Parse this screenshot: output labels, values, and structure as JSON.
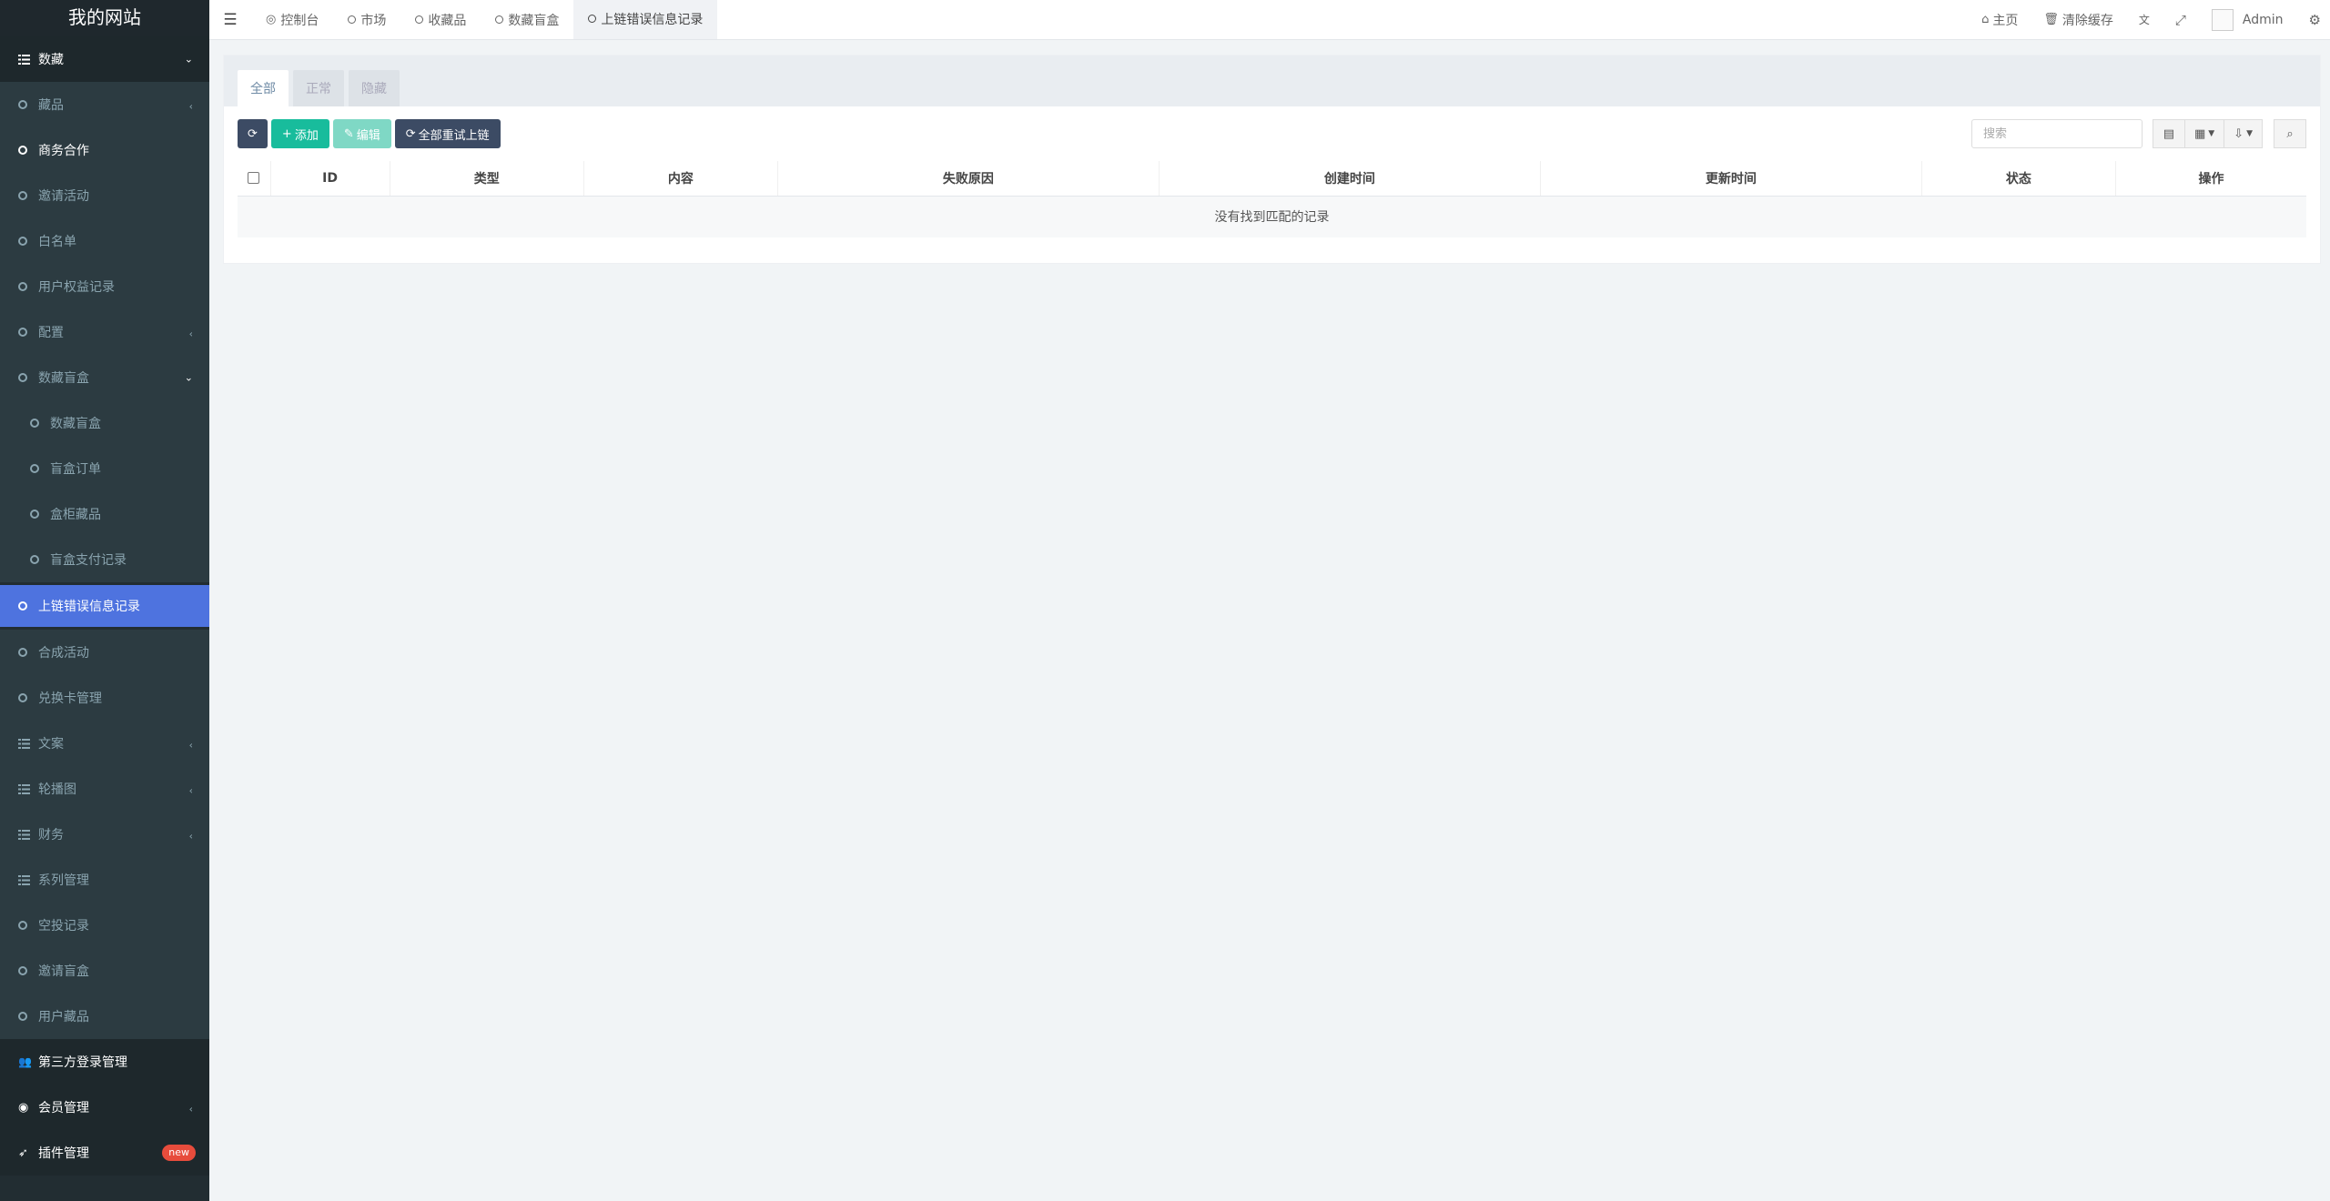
{
  "sidebar": {
    "logo": "我的网站",
    "items": [
      {
        "label": "数藏",
        "icon": "list-icon",
        "kind": "section",
        "chev": "down"
      },
      {
        "label": "藏品",
        "icon": "circle-icon",
        "kind": "sub",
        "chev": "left"
      },
      {
        "label": "商务合作",
        "icon": "circle-icon",
        "kind": "sub-white"
      },
      {
        "label": "邀请活动",
        "icon": "circle-icon",
        "kind": "sub"
      },
      {
        "label": "白名单",
        "icon": "circle-icon",
        "kind": "sub"
      },
      {
        "label": "用户权益记录",
        "icon": "circle-icon",
        "kind": "sub"
      },
      {
        "label": "配置",
        "icon": "circle-icon",
        "kind": "sub",
        "chev": "left"
      },
      {
        "label": "数藏盲盒",
        "icon": "circle-icon",
        "kind": "sub",
        "chev": "down"
      },
      {
        "label": "数藏盲盒",
        "icon": "circle-icon",
        "kind": "sub2"
      },
      {
        "label": "盲盒订单",
        "icon": "circle-icon",
        "kind": "sub2"
      },
      {
        "label": "盒柜藏品",
        "icon": "circle-icon",
        "kind": "sub2"
      },
      {
        "label": "盲盒支付记录",
        "icon": "circle-icon",
        "kind": "sub2"
      },
      {
        "label": "上链错误信息记录",
        "icon": "circle-icon",
        "kind": "active"
      },
      {
        "label": "合成活动",
        "icon": "circle-icon",
        "kind": "sub"
      },
      {
        "label": "兑换卡管理",
        "icon": "circle-icon",
        "kind": "sub"
      },
      {
        "label": "文案",
        "icon": "list-icon",
        "kind": "sub",
        "chev": "left"
      },
      {
        "label": "轮播图",
        "icon": "list-icon",
        "kind": "sub",
        "chev": "left"
      },
      {
        "label": "财务",
        "icon": "list-icon",
        "kind": "sub",
        "chev": "left"
      },
      {
        "label": "系列管理",
        "icon": "list-icon",
        "kind": "sub"
      },
      {
        "label": "空投记录",
        "icon": "circle-icon",
        "kind": "sub"
      },
      {
        "label": "邀请盲盒",
        "icon": "circle-icon",
        "kind": "sub"
      },
      {
        "label": "用户藏品",
        "icon": "circle-icon",
        "kind": "sub"
      },
      {
        "label": "第三方登录管理",
        "icon": "users-icon",
        "kind": "top"
      },
      {
        "label": "会员管理",
        "icon": "user-circle-icon",
        "kind": "top",
        "chev": "left"
      },
      {
        "label": "插件管理",
        "icon": "rocket-icon",
        "kind": "top",
        "badge": "new"
      }
    ]
  },
  "topbar": {
    "tabs": [
      {
        "label": "控制台",
        "icon": "dashboard-icon",
        "glyph": "◎"
      },
      {
        "label": "市场",
        "icon": "circle-icon"
      },
      {
        "label": "收藏品",
        "icon": "circle-icon"
      },
      {
        "label": "数藏盲盒",
        "icon": "circle-icon"
      },
      {
        "label": "上链错误信息记录",
        "icon": "circle-icon",
        "active": true
      }
    ],
    "home_label": "主页",
    "clear_cache_label": "清除缓存",
    "user_name": "Admin"
  },
  "content": {
    "subtabs": [
      {
        "label": "全部",
        "active": true
      },
      {
        "label": "正常"
      },
      {
        "label": "隐藏"
      }
    ],
    "toolbar": {
      "add_label": "添加",
      "edit_label": "编辑",
      "retry_label": "全部重试上链"
    },
    "search_placeholder": "搜索",
    "table": {
      "columns": [
        "ID",
        "类型",
        "内容",
        "失败原因",
        "创建时间",
        "更新时间",
        "状态",
        "操作"
      ],
      "empty_text": "没有找到匹配的记录"
    }
  }
}
